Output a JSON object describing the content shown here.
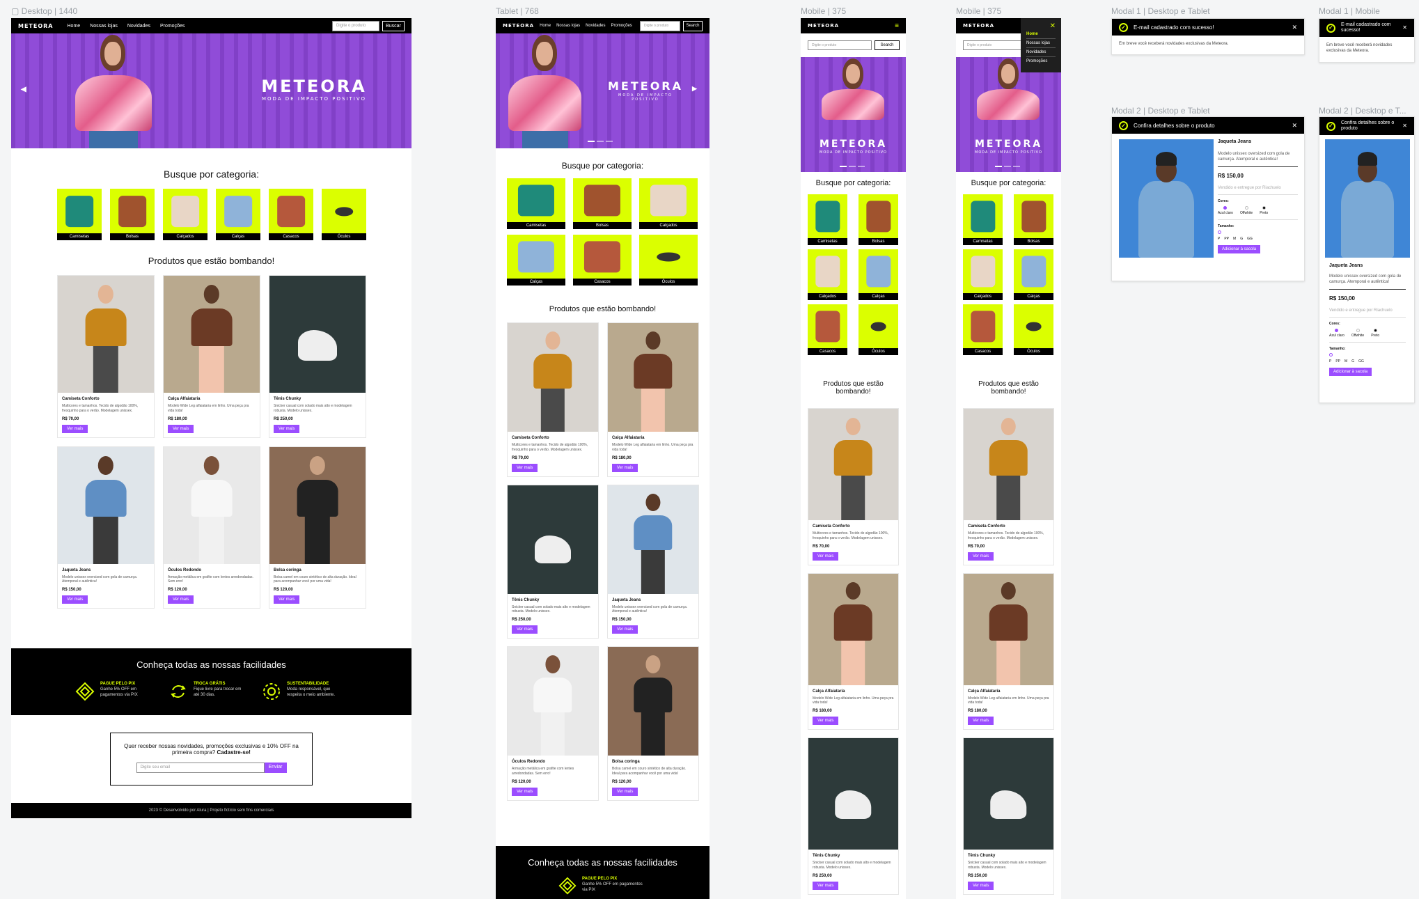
{
  "frame_labels": {
    "desktop": "Desktop | 1440",
    "tablet": "Tablet | 768",
    "mobile": "Mobile | 375",
    "mobile_menu": "Mobile | 375",
    "modal1_desktop": "Modal 1 | Desktop e Tablet",
    "modal1_mobile": "Modal 1 | Mobile",
    "modal2_desktop": "Modal 2 | Desktop e Tablet",
    "modal2_mobile": "Modal 2 | Desktop e T..."
  },
  "brand": {
    "logo": "METEORA",
    "hero_title": "METEORA",
    "hero_subtitle": "MODA DE IMPACTO POSITIVO",
    "accent": "#dbff00",
    "purple": "#8b45d6",
    "button_purple": "#9b4dff"
  },
  "nav": {
    "links": [
      "Home",
      "Nossas lojas",
      "Novidades",
      "Promoções"
    ],
    "search_placeholder": "Digite o produto",
    "search_button_desktop": "Buscar",
    "search_button_tablet": "Search",
    "search_button_mobile": "Search"
  },
  "categories": {
    "title": "Busque por categoria:",
    "items": [
      "Camisetas",
      "Bolsas",
      "Calçados",
      "Calças",
      "Casacos",
      "Óculos"
    ]
  },
  "products": {
    "title": "Produtos que estão bombando!",
    "button_label": "Ver mais",
    "items": [
      {
        "name": "Camiseta Conforto",
        "desc": "Multicores e tamanhos. Tecido de algodão 100%, fresquinho para o verão. Modelagem unissex.",
        "price": "R$ 70,00"
      },
      {
        "name": "Calça Alfaiataria",
        "desc": "Modelo Wide Leg alfaiataria em linho. Uma peça pra vida toda!",
        "price": "R$ 180,00"
      },
      {
        "name": "Tênis Chunky",
        "desc": "Snicker casual com solado mais alto e modelagem robusta. Modelo unissex.",
        "price": "R$ 250,00"
      },
      {
        "name": "Jaqueta Jeans",
        "desc": "Modelo unissex oversized com gola de camurça. Atemporal e autêntica!",
        "price": "R$ 150,00"
      },
      {
        "name": "Óculos Redondo",
        "desc": "Armação metálica em grafite com lentes arredondadas. Sem erro!",
        "price": "R$ 120,00"
      },
      {
        "name": "Bolsa coringa",
        "desc": "Bolsa camel em couro sintético de alta duração. Ideal para acompanhar você por uma vida!",
        "price": "R$ 120,00"
      }
    ]
  },
  "features": {
    "title": "Conheça todas as nossas facilidades",
    "items": [
      {
        "title": "PAGUE PELO PIX",
        "desc": "Ganhe 5% OFF em pagamentos via PIX"
      },
      {
        "title": "TROCA GRÁTIS",
        "desc": "Fique livre para trocar em até 30 dias."
      },
      {
        "title": "SUSTENTABILIDADE",
        "desc": "Moda responsável, que respeita o meio ambiente."
      }
    ]
  },
  "newsletter": {
    "text": "Quer receber nossas novidades, promoções exclusivas e 10% OFF na primeira compra?",
    "cta": "Cadastre-se!",
    "placeholder": "Digite seu email",
    "button": "Enviar"
  },
  "footer": {
    "text": "2023 © Desenvolvido por Alura | Projeto fictício sem fins comerciais"
  },
  "modal1": {
    "title": "E-mail cadastrado com sucesso!",
    "body": "Em breve você receberá novidades exclusivas da Meteora."
  },
  "modal2": {
    "title": "Confira detalhes sobre o produto",
    "product": "Jaqueta Jeans",
    "desc": "Modelo unissex oversized com gola de camurça. Atemporal e autêntica!",
    "price": "R$ 150,00",
    "seller": "Vendido e entregue por Riachuelo",
    "colors_label": "Cores:",
    "colors": [
      "Azul claro",
      "Offwhite",
      "Preto"
    ],
    "size_label": "Tamanho:",
    "sizes": [
      "P",
      "PP",
      "M",
      "G",
      "GG"
    ],
    "add_button": "Adicionar à sacola"
  }
}
